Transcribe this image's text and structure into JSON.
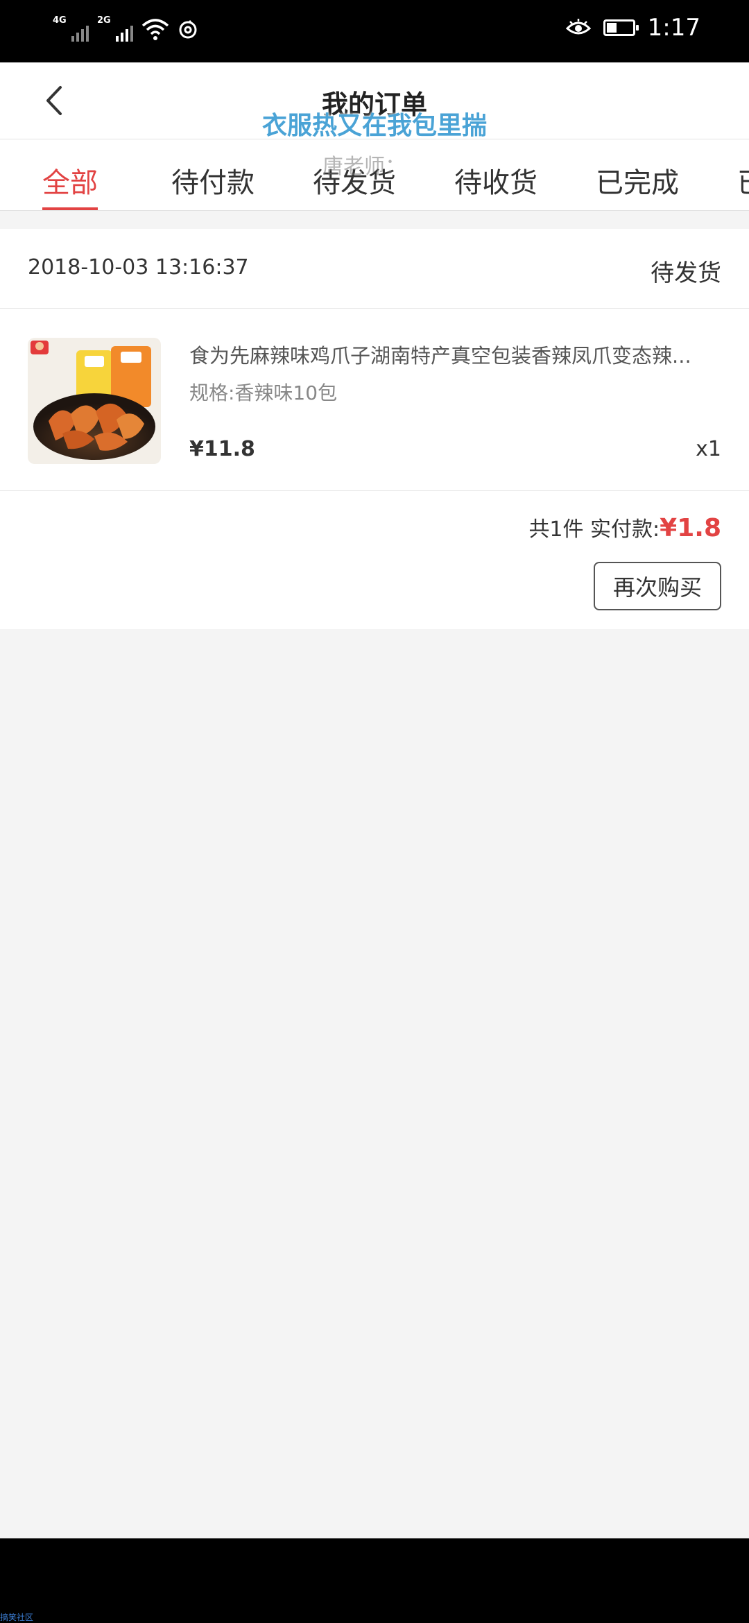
{
  "status_bar": {
    "network_1": "4G",
    "network_2": "2G",
    "time": "1:17",
    "battery_level": 0.4
  },
  "header": {
    "title": "我的订单",
    "overlay_caption": "衣服热又在我包里揣",
    "overlay_sub": "唐老师："
  },
  "tabs": [
    {
      "label": "全部",
      "active": true
    },
    {
      "label": "待付款",
      "active": false
    },
    {
      "label": "待发货",
      "active": false
    },
    {
      "label": "待收货",
      "active": false
    },
    {
      "label": "已完成",
      "active": false
    },
    {
      "label": "已",
      "active": false
    }
  ],
  "order": {
    "date": "2018-10-03 13:16:37",
    "status": "待发货",
    "item": {
      "title": "食为先麻辣味鸡爪子湖南特产真空包装香辣凤爪变态辣...",
      "spec": "规格:香辣味10包",
      "price": "¥11.8",
      "qty": "x1"
    },
    "summary_label": "共1件 实付款:",
    "paid_amount": "¥1.8",
    "buy_again_label": "再次购买"
  },
  "watermark": "搞笑社区",
  "colors": {
    "accent": "#e24343",
    "caption": "#4aa3d6"
  }
}
